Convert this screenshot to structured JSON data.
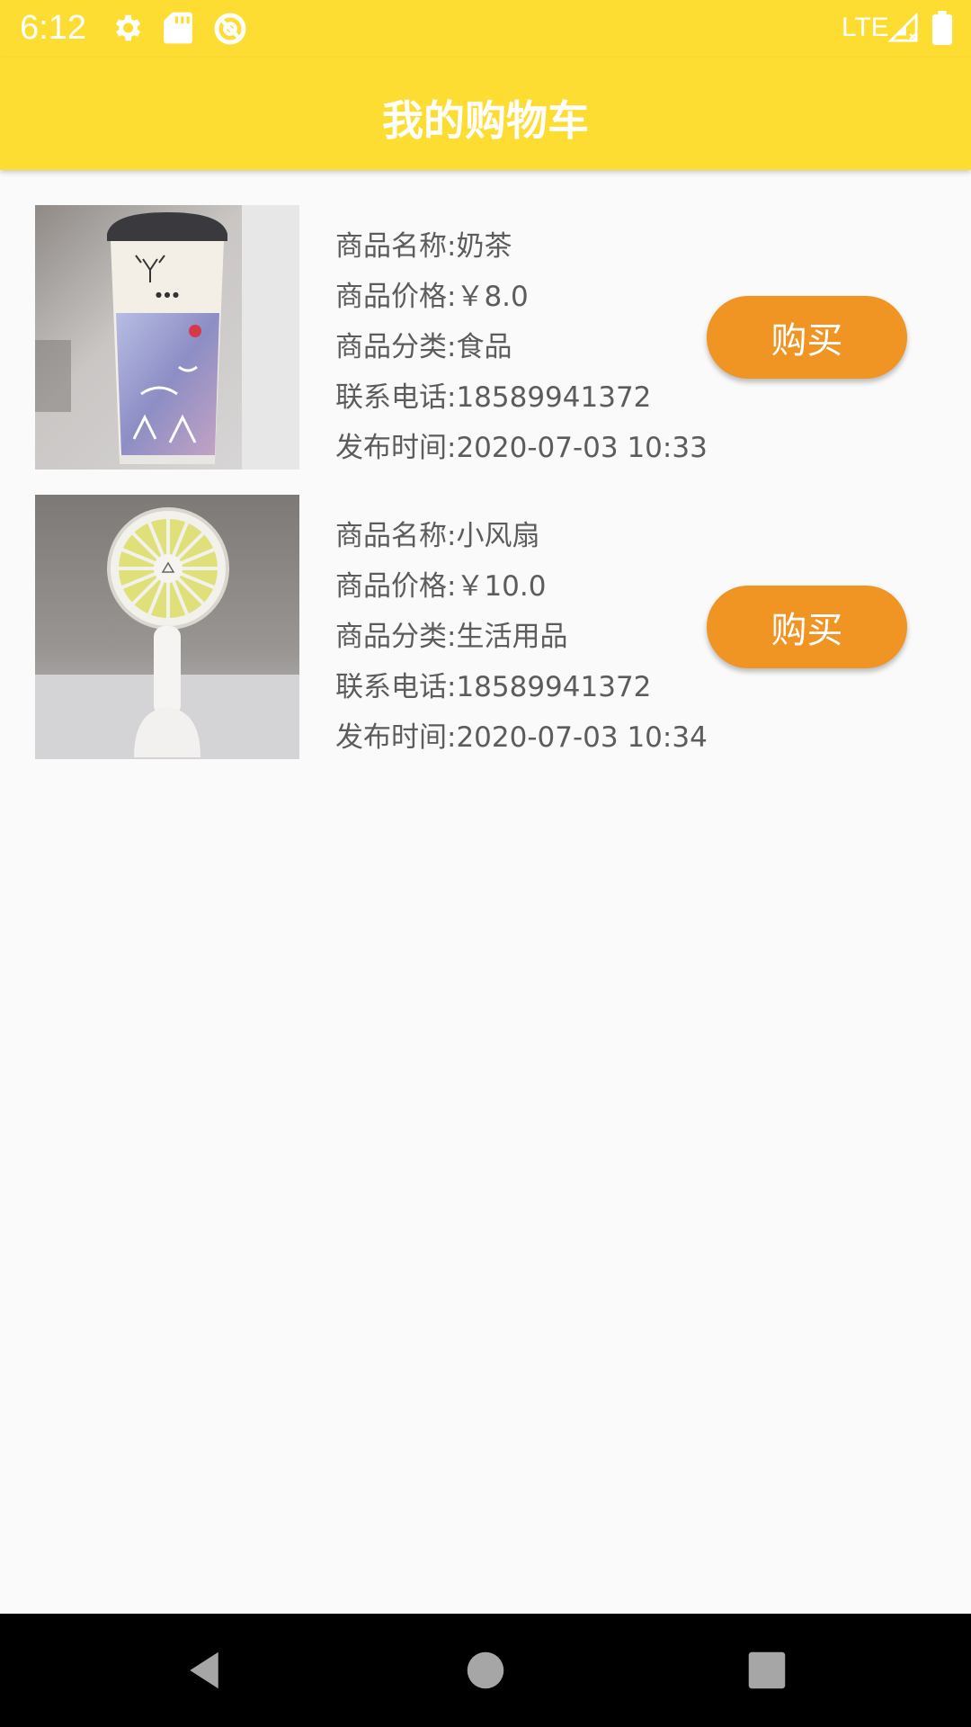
{
  "status_bar": {
    "time": "6:12",
    "network": "LTE",
    "icons": [
      "settings-icon",
      "sd-card-icon",
      "sync-icon",
      "signal-icon",
      "battery-icon"
    ]
  },
  "app_bar": {
    "title": "我的购物车"
  },
  "products": [
    {
      "name": "商品名称:奶茶",
      "price": "商品价格:￥8.0",
      "category": "商品分类:食品",
      "phone": "联系电话:18589941372",
      "time": "发布时间:2020-07-03 10:33",
      "buy_label": "购买",
      "image_icon": "milk-tea-cup-photo"
    },
    {
      "name": "商品名称:小风扇",
      "price": "商品价格:￥10.0",
      "category": "商品分类:生活用品",
      "phone": "联系电话:18589941372",
      "time": "发布时间:2020-07-03 10:34",
      "buy_label": "购买",
      "image_icon": "handheld-fan-photo"
    }
  ],
  "nav_bar": {
    "icons": [
      "back-icon",
      "home-icon",
      "recents-icon"
    ]
  },
  "colors": {
    "app_bar": "#fedd33",
    "buy_button": "#f09424",
    "background": "#fafafa",
    "text": "#5c5c5c"
  }
}
